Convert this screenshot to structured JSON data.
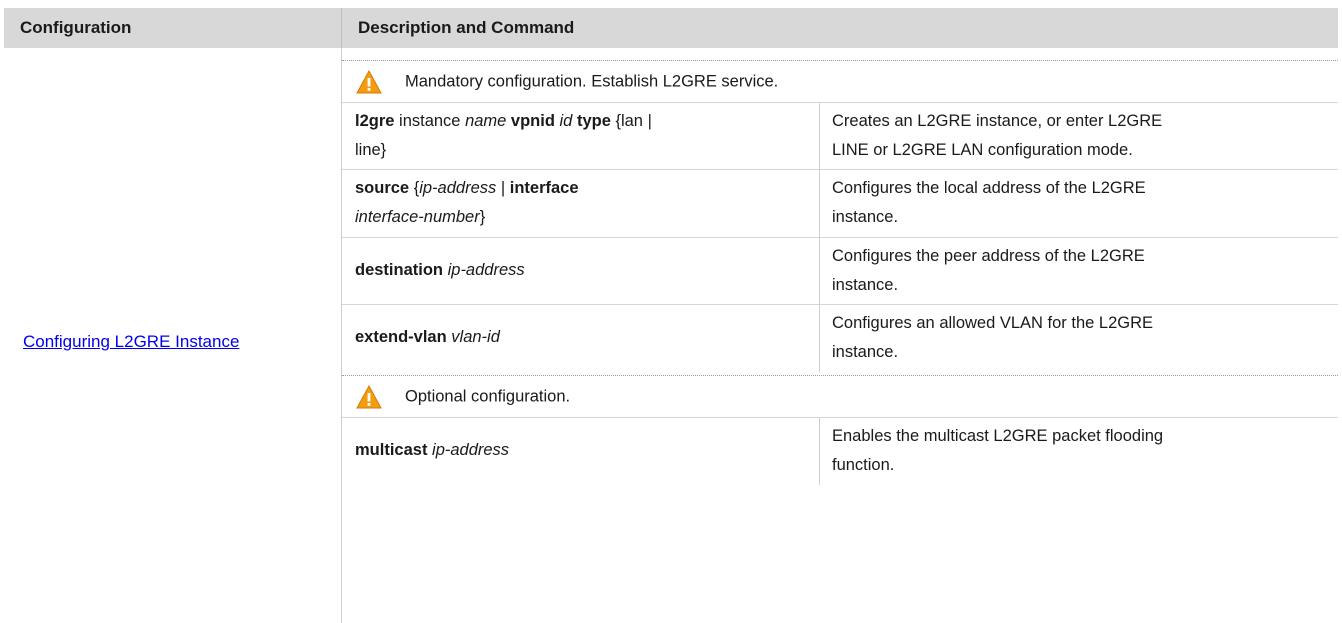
{
  "table": {
    "headers": {
      "configuration": "Configuration",
      "description": "Description and Command"
    },
    "configuration_link": "Configuring L2GRE Instance",
    "notices": {
      "mandatory": "Mandatory configuration. Establish L2GRE service.",
      "optional": "Optional configuration."
    },
    "rows": [
      {
        "cmd": {
          "k1": "l2gre",
          "t1": " instance ",
          "i1": "name",
          "k2": " vpnid ",
          "i2": "id",
          "k3": " type",
          "t2": " {lan |",
          "t3": "line}"
        },
        "desc": [
          "Creates an L2GRE instance, or enter L2GRE",
          "LINE or L2GRE LAN configuration mode."
        ]
      },
      {
        "cmd": {
          "k1": "source",
          "t1": " {",
          "i1": "ip-address",
          "t2": " | ",
          "k2": "interface",
          "i2": "interface-number",
          "t3": "}"
        },
        "desc": [
          "Configures the local address of the L2GRE",
          "instance."
        ]
      },
      {
        "cmd": {
          "k1": "destination",
          "i1": " ip-address"
        },
        "desc": [
          "Configures the peer address of the L2GRE",
          "instance."
        ]
      },
      {
        "cmd": {
          "k1": "extend-vlan",
          "i1": " vlan-id"
        },
        "desc": [
          "Configures an allowed VLAN for the L2GRE",
          "instance."
        ]
      },
      {
        "cmd": {
          "k1": "multicast",
          "i1": " ip-address"
        },
        "desc": [
          "Enables the multicast L2GRE packet flooding",
          "function."
        ]
      }
    ],
    "colors": {
      "header_bg": "#d8d8d8",
      "link": "#0000ee",
      "warning": "#f39c12"
    },
    "icons": [
      "warning-icon"
    ]
  }
}
